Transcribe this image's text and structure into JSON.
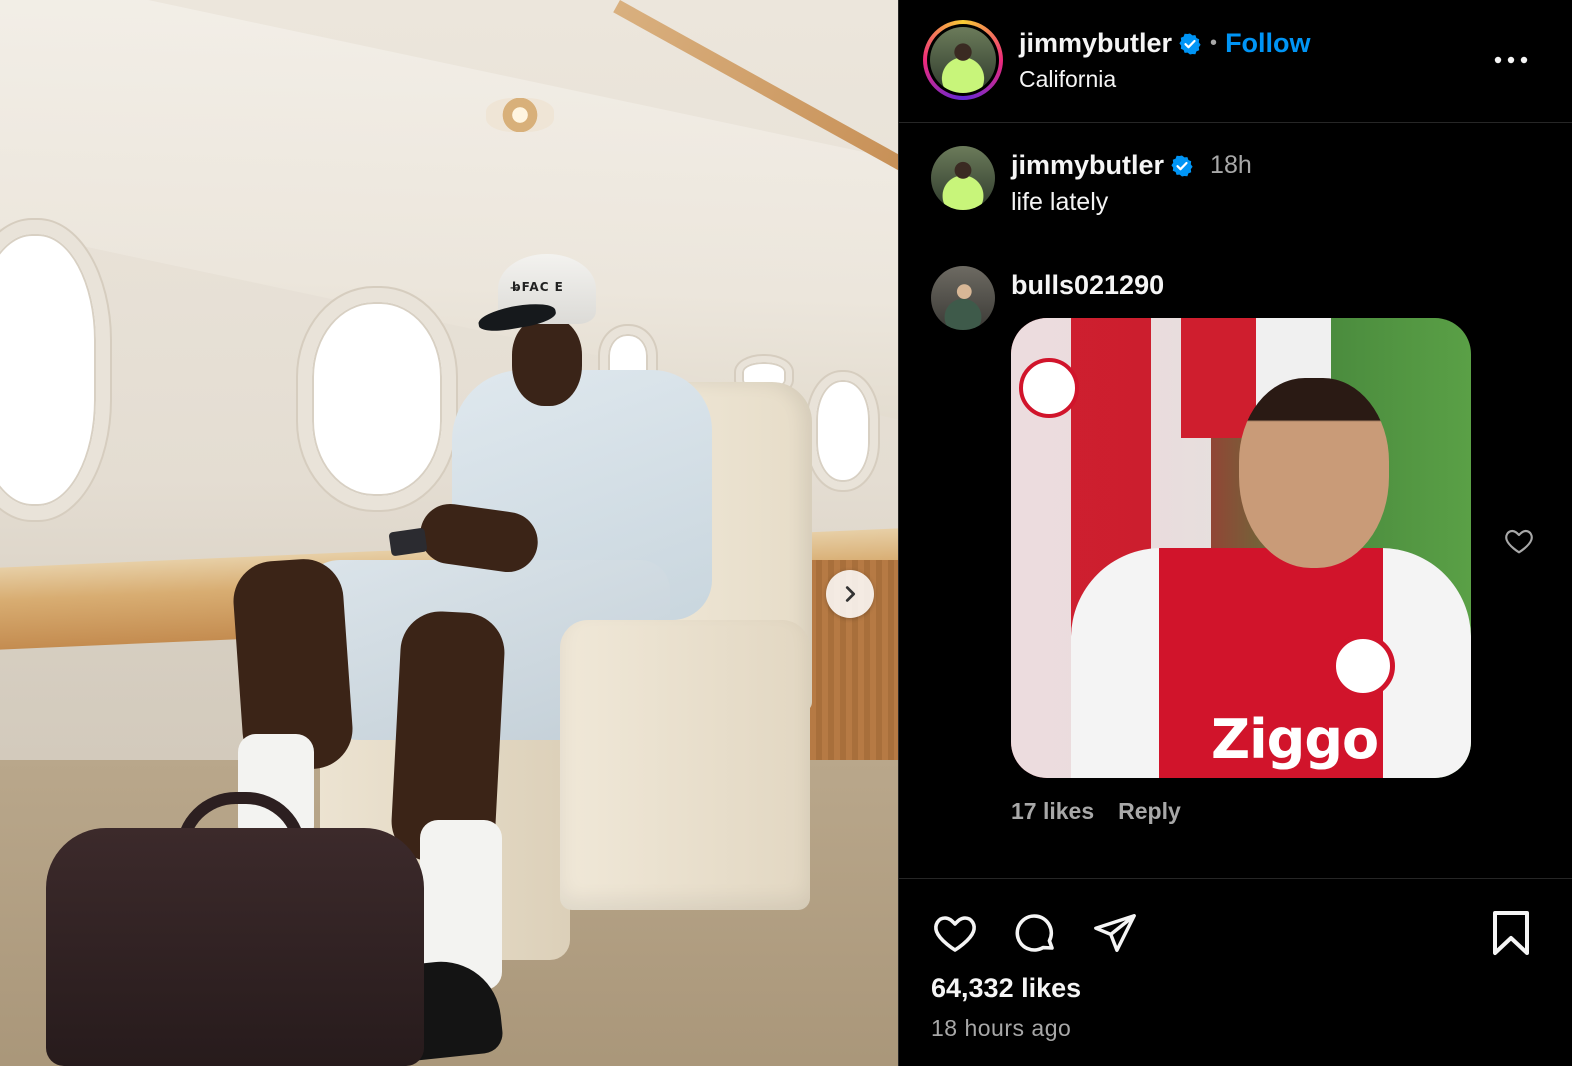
{
  "photo": {
    "cap_text": "b̶FAC E",
    "next_icon": "chevron-right-icon"
  },
  "post_header": {
    "username": "jimmybutler",
    "separator": "•",
    "follow_label": "Follow",
    "location": "California",
    "more_icon": "more-horizontal-icon"
  },
  "caption": {
    "username": "jimmybutler",
    "time": "18h",
    "text": "life lately"
  },
  "comment": {
    "username": "bulls021290",
    "media_text": "Ziggo",
    "likes": "17 likes",
    "reply_label": "Reply"
  },
  "actions": {
    "icons": [
      "heart-icon",
      "comment-icon",
      "share-icon",
      "bookmark-icon"
    ],
    "likes": "64,332 likes",
    "time_ago": "18 hours ago"
  },
  "colors": {
    "background": "#000000",
    "text": "#f5f5f5",
    "secondary_text": "#a8a8a8",
    "accent": "#0095f6",
    "divider": "#262626"
  }
}
